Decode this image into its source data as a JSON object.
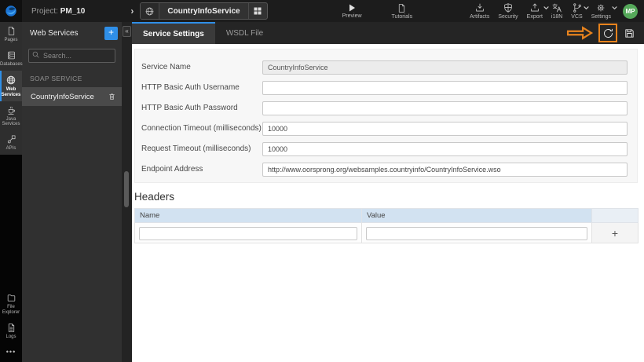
{
  "topbar": {
    "project_label": "Project:",
    "project_name": "PM_10",
    "service_chip": "CountryInfoService",
    "preview_label": "Preview",
    "tutorials_label": "Tutorials",
    "menu": [
      {
        "label": "Artifacts",
        "icon": "download-icon",
        "has_caret": false
      },
      {
        "label": "Security",
        "icon": "shield-icon",
        "has_caret": false
      },
      {
        "label": "Export",
        "icon": "upload-icon",
        "has_caret": true
      },
      {
        "label": "i18N",
        "icon": "translate-icon",
        "has_caret": false
      },
      {
        "label": "VCS",
        "icon": "branch-icon",
        "has_caret": true
      },
      {
        "label": "Settings",
        "icon": "gear-icon",
        "has_caret": true
      }
    ],
    "avatar_initials": "MP"
  },
  "sidebar": {
    "items": [
      {
        "label": "Pages",
        "icon": "page-icon",
        "active": false
      },
      {
        "label": "Databases",
        "icon": "database-icon",
        "active": false
      },
      {
        "label": "Web Services",
        "icon": "globe-icon",
        "active": true
      },
      {
        "label": "Java Services",
        "icon": "coffee-icon",
        "active": false
      },
      {
        "label": "APIs",
        "icon": "api-icon",
        "active": false
      }
    ],
    "bottom_items": [
      {
        "label": "File Explorer",
        "icon": "folder-icon"
      },
      {
        "label": "Logs",
        "icon": "log-icon"
      }
    ],
    "more_glyph": "•••"
  },
  "services_panel": {
    "title": "Web Services",
    "add_glyph": "+",
    "collapse_glyph": "«",
    "search_placeholder": "Search...",
    "section_label": "SOAP SERVICE",
    "items": [
      {
        "name": "CountryInfoService",
        "selected": true
      }
    ]
  },
  "tabs": [
    {
      "label": "Service Settings",
      "active": true
    },
    {
      "label": "WSDL File",
      "active": false
    }
  ],
  "form": {
    "fields": [
      {
        "label": "Service Name",
        "value": "CountryInfoService",
        "disabled": true
      },
      {
        "label": "HTTP Basic Auth Username",
        "value": "",
        "disabled": false
      },
      {
        "label": "HTTP Basic Auth Password",
        "value": "",
        "disabled": false
      },
      {
        "label": "Connection Timeout (milliseconds)",
        "value": "10000",
        "disabled": false
      },
      {
        "label": "Request Timeout (milliseconds)",
        "value": "10000",
        "disabled": false
      },
      {
        "label": "Endpoint Address",
        "value": "http://www.oorsprong.org/websamples.countryinfo/CountryInfoService.wso",
        "disabled": false
      }
    ]
  },
  "headers_section": {
    "title": "Headers",
    "columns": [
      "Name",
      "Value"
    ],
    "add_glyph": "+",
    "rows": [
      {
        "name": "",
        "value": ""
      }
    ]
  },
  "colors": {
    "accent_blue": "#2f8fe8",
    "annotation_orange": "#e8831d",
    "avatar_green": "#55a85a",
    "table_header_blue": "#d2e2f1"
  }
}
